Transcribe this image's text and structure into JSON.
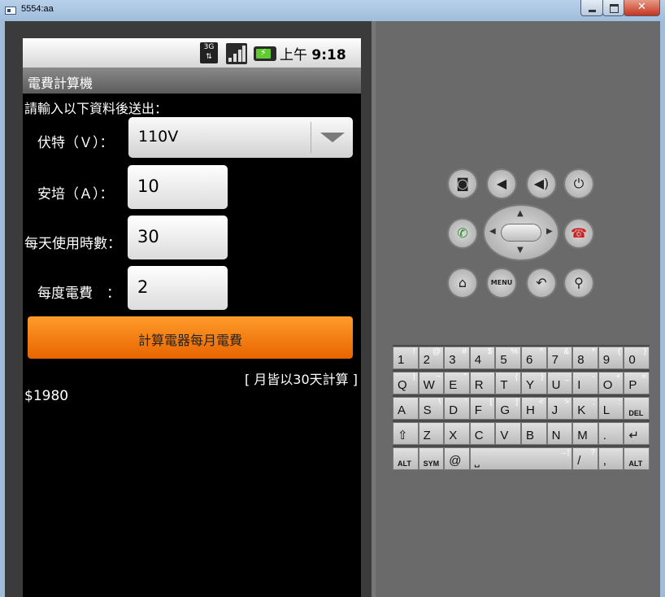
{
  "window": {
    "title": "5554:aa",
    "close_symbol": "✕"
  },
  "status_bar": {
    "network": "3G",
    "time_prefix": "上午",
    "time": "9:18"
  },
  "app": {
    "title": "電費計算機",
    "instruction": "請輸入以下資料後送出：",
    "labels": {
      "voltage": "伏特（Ｖ）：",
      "amp": "安培（Ａ）：",
      "hours": "每天使用時數：",
      "rate": "每度電費　："
    },
    "voltage_selected": "110V",
    "amp_value": "10",
    "hours_value": "30",
    "rate_value": "2",
    "button_label": "計算電器每月電費",
    "note": "[ 月皆以30天計算 ]",
    "result": "$1980"
  },
  "controls": {
    "menu_label": "MENU"
  },
  "keyboard": {
    "rows": [
      [
        {
          "m": "1",
          "s": "!"
        },
        {
          "m": "2",
          "s": "@"
        },
        {
          "m": "3",
          "s": "#"
        },
        {
          "m": "4",
          "s": "$"
        },
        {
          "m": "5",
          "s": "%"
        },
        {
          "m": "6",
          "s": "^"
        },
        {
          "m": "7",
          "s": "&"
        },
        {
          "m": "8",
          "s": "*"
        },
        {
          "m": "9",
          "s": "("
        },
        {
          "m": "0",
          "s": ")"
        }
      ],
      [
        {
          "m": "Q",
          "s": "|"
        },
        {
          "m": "W",
          "s": "~"
        },
        {
          "m": "E",
          "s": "\""
        },
        {
          "m": "R",
          "s": "`"
        },
        {
          "m": "T",
          "s": "{"
        },
        {
          "m": "Y",
          "s": "}"
        },
        {
          "m": "U",
          "s": "_"
        },
        {
          "m": "I",
          "s": "-"
        },
        {
          "m": "O",
          "s": "+"
        },
        {
          "m": "P",
          "s": "="
        }
      ],
      [
        {
          "m": "A",
          "s": ""
        },
        {
          "m": "S",
          "s": "\\"
        },
        {
          "m": "D",
          "s": "'"
        },
        {
          "m": "F",
          "s": "["
        },
        {
          "m": "G",
          "s": "]"
        },
        {
          "m": "H",
          "s": "<"
        },
        {
          "m": "J",
          "s": ">"
        },
        {
          "m": "K",
          "s": ";"
        },
        {
          "m": "L",
          "s": ":"
        },
        {
          "m": "DEL",
          "s": ""
        }
      ],
      [
        {
          "m": "⇧",
          "s": ""
        },
        {
          "m": "Z",
          "s": ""
        },
        {
          "m": "X",
          "s": ""
        },
        {
          "m": "C",
          "s": ""
        },
        {
          "m": "V",
          "s": ""
        },
        {
          "m": "B",
          "s": ""
        },
        {
          "m": "N",
          "s": ""
        },
        {
          "m": "M",
          "s": ""
        },
        {
          "m": ".",
          "s": ""
        },
        {
          "m": "↵",
          "s": ""
        }
      ],
      [
        {
          "m": "ALT",
          "s": ""
        },
        {
          "m": "SYM",
          "s": ""
        },
        {
          "m": "@",
          "s": ""
        },
        {
          "m": "⎵",
          "s": "→|"
        },
        {
          "m": "/",
          "s": "?"
        },
        {
          "m": ",",
          "s": ""
        },
        {
          "m": "ALT",
          "s": ""
        }
      ]
    ]
  }
}
